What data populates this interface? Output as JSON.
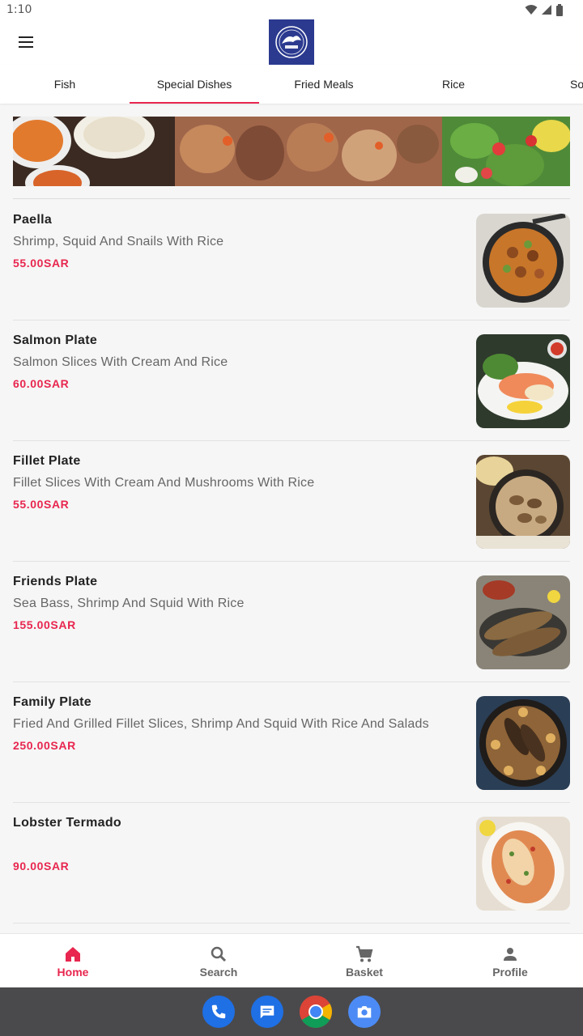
{
  "status_bar": {
    "time": "1:10"
  },
  "tabs": [
    {
      "label": "Fish",
      "active": false
    },
    {
      "label": "Special Dishes",
      "active": true
    },
    {
      "label": "Fried Meals",
      "active": false
    },
    {
      "label": "Rice",
      "active": false
    },
    {
      "label": "So",
      "active": false
    }
  ],
  "items": [
    {
      "name": "Paella",
      "description": "Shrimp, Squid And Snails With Rice",
      "price": "55.00SAR"
    },
    {
      "name": "Salmon Plate",
      "description": "Salmon Slices With Cream And Rice",
      "price": "60.00SAR"
    },
    {
      "name": "Fillet Plate",
      "description": "Fillet Slices With Cream And Mushrooms With Rice",
      "price": "55.00SAR"
    },
    {
      "name": "Friends Plate",
      "description": "Sea Bass, Shrimp And Squid With Rice",
      "price": "155.00SAR"
    },
    {
      "name": "Family Plate",
      "description": "Fried And Grilled Fillet Slices, Shrimp And Squid With Rice And Salads",
      "price": "250.00SAR"
    },
    {
      "name": "Lobster Termado",
      "description": "",
      "price": "90.00SAR"
    }
  ],
  "bottom_nav": [
    {
      "label": "Home",
      "icon": "home-icon",
      "active": true
    },
    {
      "label": "Search",
      "icon": "search-icon",
      "active": false
    },
    {
      "label": "Basket",
      "icon": "cart-icon",
      "active": false
    },
    {
      "label": "Profile",
      "icon": "person-icon",
      "active": false
    }
  ],
  "colors": {
    "accent": "#e8264f",
    "logo_bg": "#2b3a8f",
    "dock_bg": "#4a4a4c"
  }
}
